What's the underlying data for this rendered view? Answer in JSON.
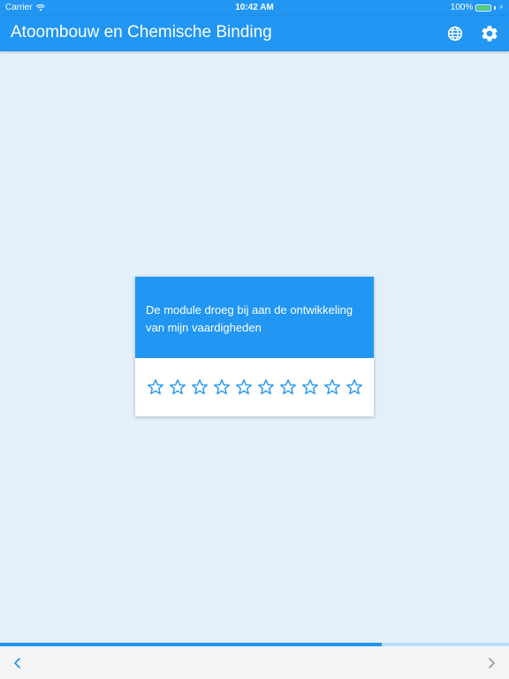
{
  "status_bar": {
    "carrier": "Carrier",
    "time": "10:42 AM",
    "battery": "100%",
    "battery_level": 1.0
  },
  "app_bar": {
    "title": "Atoombouw en Chemische Binding",
    "icons": [
      "globe-icon",
      "settings-icon"
    ]
  },
  "card": {
    "statement": "De module droeg bij aan de ontwikkeling van mijn vaardigheden",
    "rating_max": 10,
    "rating_value": 0
  },
  "progress": {
    "value": 0.75
  },
  "nav": {
    "prev_icon": "chevron-left-icon",
    "next_icon": "chevron-right-icon"
  },
  "colors": {
    "primary": "#2196f3",
    "background": "#e3f0fc",
    "progress_track": "#bbdcfb",
    "nav_disabled": "#9e9e9e"
  }
}
